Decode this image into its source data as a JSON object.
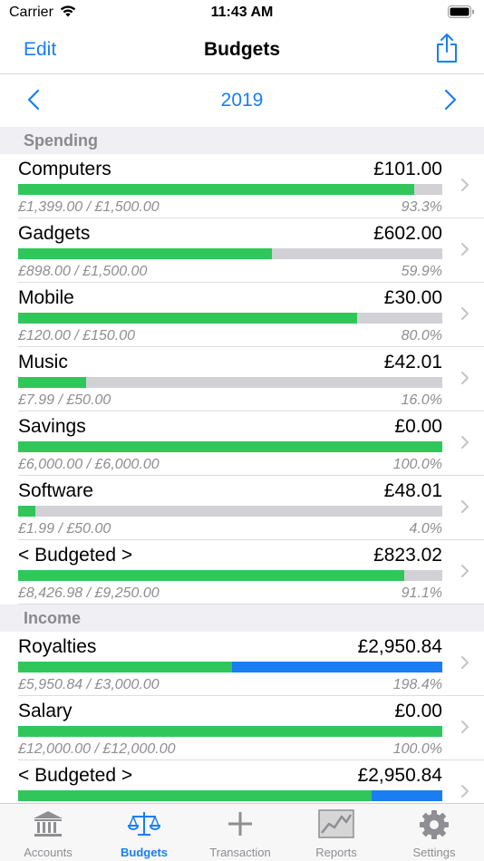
{
  "status": {
    "carrier": "Carrier",
    "time": "11:43 AM"
  },
  "nav": {
    "edit": "Edit",
    "title": "Budgets"
  },
  "year": {
    "label": "2019"
  },
  "colors": {
    "accent": "#1a7ef2",
    "progress": "#31c65a",
    "over": "#1a7ef2",
    "track": "#d1d1d6"
  },
  "spending": {
    "header": "Spending",
    "rows": [
      {
        "name": "Computers",
        "amount": "£101.00",
        "detail": "£1,399.00 / £1,500.00",
        "pct": "93.3%",
        "progress": 0.933
      },
      {
        "name": "Gadgets",
        "amount": "£602.00",
        "detail": "£898.00 / £1,500.00",
        "pct": "59.9%",
        "progress": 0.599
      },
      {
        "name": "Mobile",
        "amount": "£30.00",
        "detail": "£120.00 / £150.00",
        "pct": "80.0%",
        "progress": 0.8
      },
      {
        "name": "Music",
        "amount": "£42.01",
        "detail": "£7.99 / £50.00",
        "pct": "16.0%",
        "progress": 0.16
      },
      {
        "name": "Savings",
        "amount": "£0.00",
        "detail": "£6,000.00 / £6,000.00",
        "pct": "100.0%",
        "progress": 1.0
      },
      {
        "name": "Software",
        "amount": "£48.01",
        "detail": "£1.99 / £50.00",
        "pct": "4.0%",
        "progress": 0.04
      },
      {
        "name": "< Budgeted >",
        "amount": "£823.02",
        "detail": "£8,426.98 / £9,250.00",
        "pct": "91.1%",
        "progress": 0.911
      }
    ]
  },
  "income": {
    "header": "Income",
    "rows": [
      {
        "name": "Royalties",
        "amount": "£2,950.84",
        "detail": "£5,950.84 / £3,000.00",
        "pct": "198.4%",
        "progress": 1.984
      },
      {
        "name": "Salary",
        "amount": "£0.00",
        "detail": "£12,000.00 / £12,000.00",
        "pct": "100.0%",
        "progress": 1.0
      },
      {
        "name": "< Budgeted >",
        "amount": "£2,950.84",
        "detail": "",
        "pct": "",
        "progress": 1.2
      }
    ]
  },
  "tabs": [
    {
      "label": "Accounts",
      "icon": "bank-icon"
    },
    {
      "label": "Budgets",
      "icon": "scales-icon"
    },
    {
      "label": "Transaction",
      "icon": "plus-icon"
    },
    {
      "label": "Reports",
      "icon": "chart-icon"
    },
    {
      "label": "Settings",
      "icon": "gear-icon"
    }
  ]
}
